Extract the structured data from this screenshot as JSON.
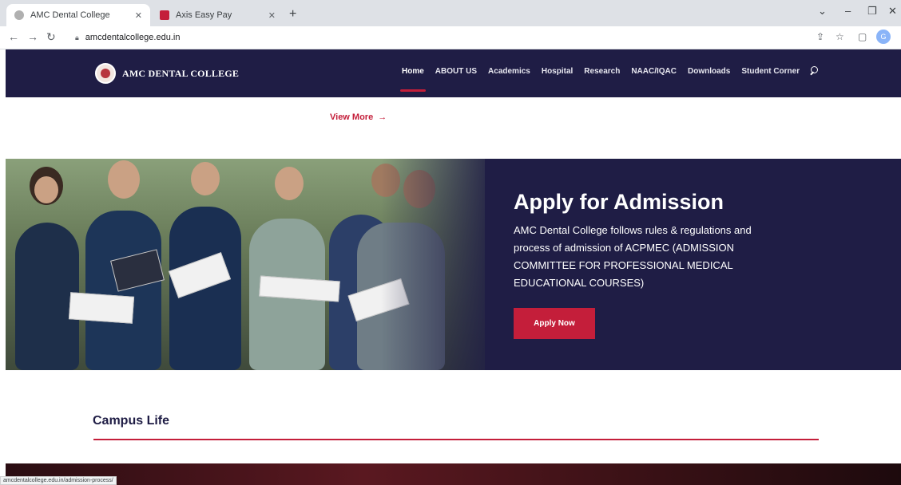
{
  "browser": {
    "tabs": [
      {
        "title": "AMC Dental College",
        "favicon_color": "#b0b0b0"
      },
      {
        "title": "Axis Easy Pay",
        "favicon_color": "#c41e3a"
      }
    ],
    "new_tab": "+",
    "address": "amcdentalcollege.edu.in",
    "status_url": "amcdentalcollege.edu.in/admission-process/",
    "profile_initial": "G"
  },
  "site": {
    "brand": "AMC DENTAL COLLEGE",
    "menu": [
      "Home",
      "ABOUT US",
      "Academics",
      "Hospital",
      "Research",
      "NAAC/IQAC",
      "Downloads",
      "Student Corner"
    ],
    "view_more": "View More",
    "view_more_arrow": "→"
  },
  "admission": {
    "title": "Apply for Admission",
    "text": "AMC Dental College follows rules & regulations and process of admission of ACPMEC (ADMISSION COMMITTEE FOR PROFESSIONAL MEDICAL EDUCATIONAL COURSES)",
    "button": "Apply Now"
  },
  "campus": {
    "title": "Campus Life"
  },
  "colors": {
    "navy": "#1f1d45",
    "accent": "#c41e3a"
  }
}
